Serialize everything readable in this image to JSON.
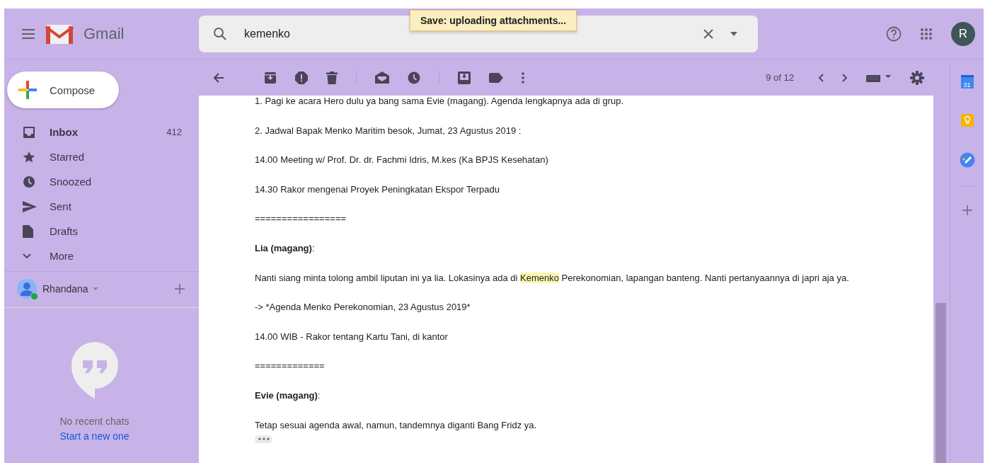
{
  "header": {
    "app_name": "Gmail",
    "search": {
      "value": "kemenko"
    },
    "avatar_letter": "R"
  },
  "toast": "Save: uploading attachments...",
  "compose": "Compose",
  "sidebar": {
    "items": [
      {
        "kind": "inbox",
        "label": "Inbox",
        "count": "412",
        "selected": true
      },
      {
        "kind": "star",
        "label": "Starred",
        "selected": false
      },
      {
        "kind": "clock",
        "label": "Snoozed",
        "selected": false
      },
      {
        "kind": "send",
        "label": "Sent",
        "selected": false
      },
      {
        "kind": "draft",
        "label": "Drafts",
        "selected": false
      },
      {
        "kind": "more",
        "label": "More",
        "selected": false
      }
    ],
    "chat_user": {
      "name": "Rhandana",
      "online": true
    },
    "chat_empty": "No recent chats",
    "chat_link": "Start a new one"
  },
  "toolbar": {
    "counter": "9 of 12"
  },
  "message": {
    "lines": [
      {
        "segments": [
          {
            "text": "1. Pagi ke acara Hero dulu ya bang sama Evie (magang). Agenda lengkapnya ada di grup.",
            "bold": false,
            "highlight": false
          }
        ]
      },
      {
        "segments": [
          {
            "text": "2. Jadwal Bapak Menko Maritim besok, Jumat, 23 Agustus 2019 :",
            "bold": false,
            "highlight": false
          }
        ]
      },
      {
        "segments": [
          {
            "text": "14.00 Meeting w/ Prof. Dr. dr. Fachmi Idris, M.kes (Ka BPJS Kesehatan)",
            "bold": false,
            "highlight": false
          }
        ]
      },
      {
        "segments": [
          {
            "text": "14.30 Rakor mengenai Proyek Peningkatan Ekspor Terpadu",
            "bold": false,
            "highlight": false
          }
        ]
      },
      {
        "segments": [
          {
            "text": "=================",
            "bold": false,
            "highlight": false
          }
        ]
      },
      {
        "segments": [
          {
            "text": "Lia (magang)",
            "bold": true,
            "highlight": false
          },
          {
            "text": ":",
            "bold": false,
            "highlight": false
          }
        ]
      },
      {
        "segments": [
          {
            "text": "Nanti siang minta tolong ambil liputan ini ya lia. Lokasinya ada di ",
            "bold": false,
            "highlight": false
          },
          {
            "text": "Kemenko",
            "bold": false,
            "highlight": true
          },
          {
            "text": " Perekonomian, lapangan banteng. Nanti pertanyaannya di japri aja ya.",
            "bold": false,
            "highlight": false
          }
        ]
      },
      {
        "segments": [
          {
            "text": "-> *Agenda Menko Perekonomian, 23 Agustus 2019*",
            "bold": false,
            "highlight": false
          }
        ]
      },
      {
        "segments": [
          {
            "text": "14.00 WIB - Rakor tentang Kartu Tani, di kantor",
            "bold": false,
            "highlight": false
          }
        ]
      },
      {
        "segments": [
          {
            "text": "=============",
            "bold": false,
            "highlight": false
          }
        ]
      },
      {
        "segments": [
          {
            "text": "Evie (magang)",
            "bold": true,
            "highlight": false
          },
          {
            "text": ":",
            "bold": false,
            "highlight": false
          }
        ]
      },
      {
        "segments": [
          {
            "text": "Tetap sesuai agenda awal, namun, tandemnya diganti Bang Fridz ya.",
            "bold": false,
            "highlight": false
          }
        ]
      }
    ]
  },
  "right_rail": {
    "calendar_day": "31"
  }
}
